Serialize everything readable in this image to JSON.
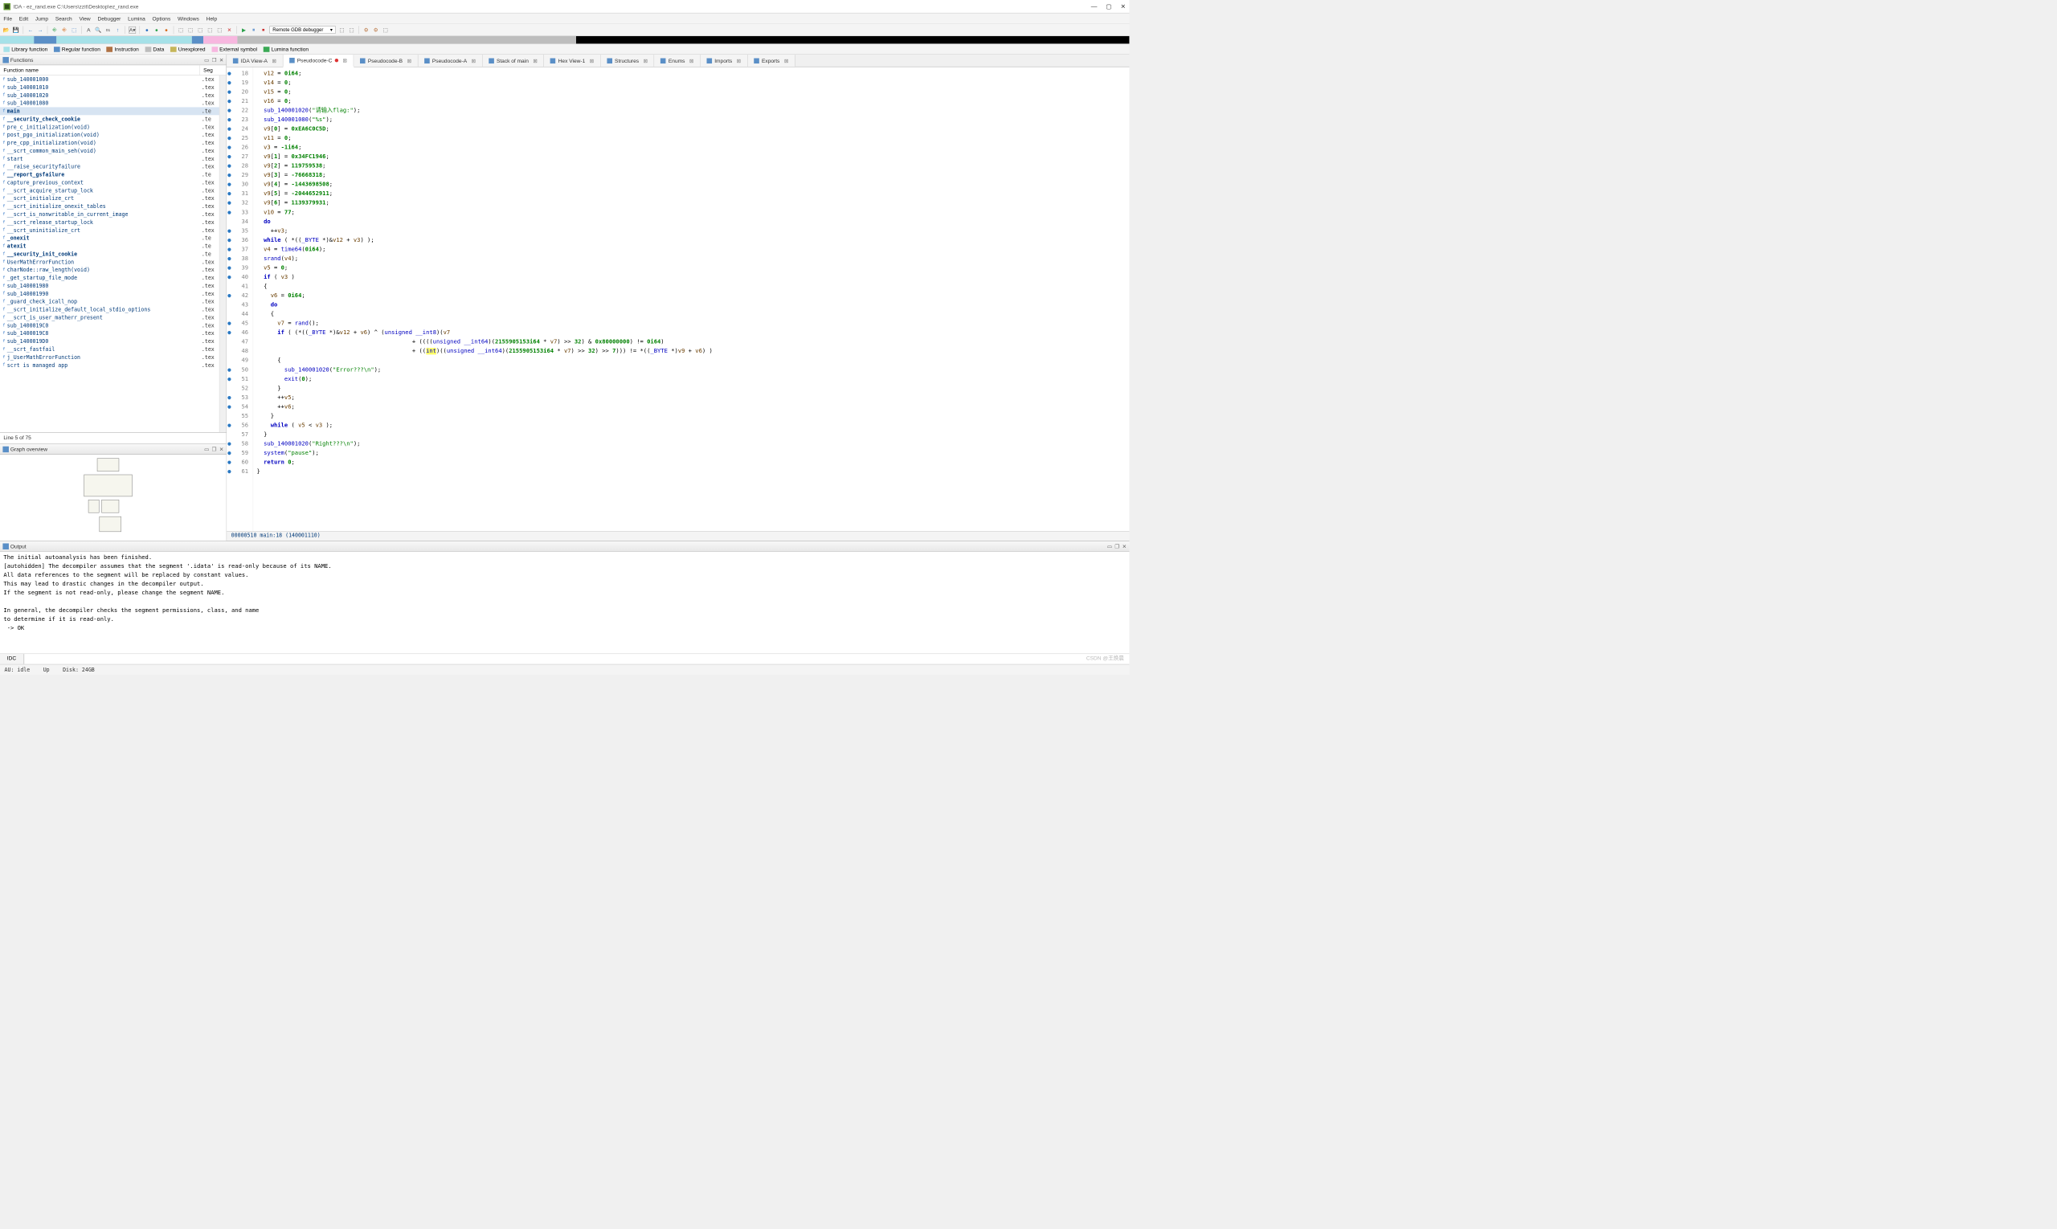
{
  "window": {
    "title": "IDA - ez_rand.exe C:\\Users\\zzit\\Desktop\\ez_rand.exe",
    "controls": {
      "min": "—",
      "max": "▢",
      "close": "✕"
    }
  },
  "menu": [
    "File",
    "Edit",
    "Jump",
    "Search",
    "View",
    "Debugger",
    "Lumina",
    "Options",
    "Windows",
    "Help"
  ],
  "toolbar": {
    "debugger": "Remote GDB debugger"
  },
  "legend": [
    {
      "color": "#a6e1e8",
      "label": "Library function"
    },
    {
      "color": "#5a8fc7",
      "label": "Regular function"
    },
    {
      "color": "#b07244",
      "label": "Instruction"
    },
    {
      "color": "#bdbdbd",
      "label": "Data"
    },
    {
      "color": "#c6b65a",
      "label": "Unexplored"
    },
    {
      "color": "#f7b7df",
      "label": "External symbol"
    },
    {
      "color": "#3aa955",
      "label": "Lumina function"
    }
  ],
  "functions": {
    "title": "Functions",
    "columns": [
      "Function name",
      "Seg"
    ],
    "line_status": "Line 5 of 75",
    "rows": [
      {
        "n": "sub_140001000",
        "s": ".tex",
        "b": false
      },
      {
        "n": "sub_140001010",
        "s": ".tex",
        "b": false
      },
      {
        "n": "sub_140001020",
        "s": ".tex",
        "b": false
      },
      {
        "n": "sub_140001080",
        "s": ".tex",
        "b": false
      },
      {
        "n": "main",
        "s": ".te",
        "b": true,
        "sel": true
      },
      {
        "n": "__security_check_cookie",
        "s": ".te",
        "b": true
      },
      {
        "n": "pre_c_initialization(void)",
        "s": ".tex",
        "b": false
      },
      {
        "n": "post_pgo_initialization(void)",
        "s": ".tex",
        "b": false
      },
      {
        "n": "pre_cpp_initialization(void)",
        "s": ".tex",
        "b": false
      },
      {
        "n": "__scrt_common_main_seh(void)",
        "s": ".tex",
        "b": false
      },
      {
        "n": "start",
        "s": ".tex",
        "b": false
      },
      {
        "n": "__raise_securityfailure",
        "s": ".tex",
        "b": false
      },
      {
        "n": "__report_gsfailure",
        "s": ".te",
        "b": true
      },
      {
        "n": "capture_previous_context",
        "s": ".tex",
        "b": false
      },
      {
        "n": "__scrt_acquire_startup_lock",
        "s": ".tex",
        "b": false
      },
      {
        "n": "__scrt_initialize_crt",
        "s": ".tex",
        "b": false
      },
      {
        "n": "__scrt_initialize_onexit_tables",
        "s": ".tex",
        "b": false
      },
      {
        "n": "__scrt_is_nonwritable_in_current_image",
        "s": ".tex",
        "b": false
      },
      {
        "n": "__scrt_release_startup_lock",
        "s": ".tex",
        "b": false
      },
      {
        "n": "__scrt_uninitialize_crt",
        "s": ".tex",
        "b": false
      },
      {
        "n": "_onexit",
        "s": ".te",
        "b": true
      },
      {
        "n": "atexit",
        "s": ".te",
        "b": true
      },
      {
        "n": "__security_init_cookie",
        "s": ".te",
        "b": true
      },
      {
        "n": "UserMathErrorFunction",
        "s": ".tex",
        "b": false
      },
      {
        "n": "charNode::raw_length(void)",
        "s": ".tex",
        "b": false
      },
      {
        "n": "_get_startup_file_mode",
        "s": ".tex",
        "b": false
      },
      {
        "n": "sub_140001980",
        "s": ".tex",
        "b": false
      },
      {
        "n": "sub_140001990",
        "s": ".tex",
        "b": false
      },
      {
        "n": "_guard_check_icall_nop",
        "s": ".tex",
        "b": false
      },
      {
        "n": "__scrt_initialize_default_local_stdio_options",
        "s": ".tex",
        "b": false
      },
      {
        "n": "__scrt_is_user_matherr_present",
        "s": ".tex",
        "b": false
      },
      {
        "n": "sub_1400019C0",
        "s": ".tex",
        "b": false
      },
      {
        "n": "sub_1400019C8",
        "s": ".tex",
        "b": false
      },
      {
        "n": "sub_1400019D0",
        "s": ".tex",
        "b": false
      },
      {
        "n": "__scrt_fastfail",
        "s": ".tex",
        "b": false
      },
      {
        "n": "j_UserMathErrorFunction",
        "s": ".tex",
        "b": false
      },
      {
        "n": "scrt is managed app",
        "s": ".tex",
        "b": false
      }
    ]
  },
  "graph": {
    "title": "Graph overview"
  },
  "tabs": [
    {
      "label": "IDA View-A",
      "active": false
    },
    {
      "label": "Pseudocode-C",
      "active": true,
      "dot": true
    },
    {
      "label": "Pseudocode-B",
      "active": false
    },
    {
      "label": "Pseudocode-A",
      "active": false
    },
    {
      "label": "Stack of main",
      "active": false
    },
    {
      "label": "Hex View-1",
      "active": false
    },
    {
      "label": "Structures",
      "active": false
    },
    {
      "label": "Enums",
      "active": false
    },
    {
      "label": "Imports",
      "active": false
    },
    {
      "label": "Exports",
      "active": false
    }
  ],
  "code": {
    "lines": [
      {
        "n": 18,
        "bp": true,
        "html": "  <span class='var'>v12</span> = <span class='num'>0i64</span>;"
      },
      {
        "n": 19,
        "bp": true,
        "html": "  <span class='var'>v14</span> = <span class='num'>0</span>;"
      },
      {
        "n": 20,
        "bp": true,
        "html": "  <span class='var'>v15</span> = <span class='num'>0</span>;"
      },
      {
        "n": 21,
        "bp": true,
        "html": "  <span class='var'>v16</span> = <span class='num'>0</span>;"
      },
      {
        "n": 22,
        "bp": true,
        "html": "  <span class='fn'>sub_140001020</span>(<span class='str'>\"请输入flag:\"</span>);"
      },
      {
        "n": 23,
        "bp": true,
        "html": "  <span class='fn'>sub_140001080</span>(<span class='str'>\"%s\"</span>);"
      },
      {
        "n": 24,
        "bp": true,
        "html": "  <span class='var'>v9</span>[<span class='num'>0</span>] = <span class='num'>0xEA6C0C5D</span>;"
      },
      {
        "n": 25,
        "bp": true,
        "html": "  <span class='var'>v11</span> = <span class='num'>0</span>;"
      },
      {
        "n": 26,
        "bp": true,
        "html": "  <span class='var'>v3</span> = <span class='num'>-1i64</span>;"
      },
      {
        "n": 27,
        "bp": true,
        "html": "  <span class='var'>v9</span>[<span class='num'>1</span>] = <span class='num'>0x34FC1946</span>;"
      },
      {
        "n": 28,
        "bp": true,
        "html": "  <span class='var'>v9</span>[<span class='num'>2</span>] = <span class='num'>119759538</span>;"
      },
      {
        "n": 29,
        "bp": true,
        "html": "  <span class='var'>v9</span>[<span class='num'>3</span>] = <span class='num'>-76668318</span>;"
      },
      {
        "n": 30,
        "bp": true,
        "html": "  <span class='var'>v9</span>[<span class='num'>4</span>] = <span class='num'>-1443698508</span>;"
      },
      {
        "n": 31,
        "bp": true,
        "html": "  <span class='var'>v9</span>[<span class='num'>5</span>] = <span class='num'>-2044652911</span>;"
      },
      {
        "n": 32,
        "bp": true,
        "html": "  <span class='var'>v9</span>[<span class='num'>6</span>] = <span class='num'>1139379931</span>;"
      },
      {
        "n": 33,
        "bp": true,
        "html": "  <span class='var'>v10</span> = <span class='num'>77</span>;"
      },
      {
        "n": 34,
        "bp": false,
        "html": "  <span class='kw'>do</span>"
      },
      {
        "n": 35,
        "bp": true,
        "html": "    ++<span class='var'>v3</span>;"
      },
      {
        "n": 36,
        "bp": true,
        "html": "  <span class='kw'>while</span> ( *((<span class='ty'>_BYTE</span> *)&amp;<span class='var'>v12</span> + <span class='var'>v3</span>) );"
      },
      {
        "n": 37,
        "bp": true,
        "html": "  <span class='var'>v4</span> = <span class='fn'>time64</span>(<span class='num'>0i64</span>);"
      },
      {
        "n": 38,
        "bp": true,
        "html": "  <span class='fn'>srand</span>(<span class='var'>v4</span>);"
      },
      {
        "n": 39,
        "bp": true,
        "html": "  <span class='var'>v5</span> = <span class='num'>0</span>;"
      },
      {
        "n": 40,
        "bp": true,
        "html": "  <span class='kw'>if</span> ( <span class='var'>v3</span> )"
      },
      {
        "n": 41,
        "bp": false,
        "html": "  {"
      },
      {
        "n": 42,
        "bp": true,
        "html": "    <span class='var'>v6</span> = <span class='num'>0i64</span>;"
      },
      {
        "n": 43,
        "bp": false,
        "html": "    <span class='kw'>do</span>"
      },
      {
        "n": 44,
        "bp": false,
        "html": "    {"
      },
      {
        "n": 45,
        "bp": true,
        "html": "      <span class='var'>v7</span> = <span class='fn'>rand</span>();"
      },
      {
        "n": 46,
        "bp": true,
        "html": "      <span class='kw'>if</span> ( (*((<span class='ty'>_BYTE</span> *)&amp;<span class='var'>v12</span> + <span class='var'>v6</span>) ^ (<span class='ty'>unsigned</span> <span class='ty'>__int8</span>)(<span class='var'>v7</span>"
      },
      {
        "n": 47,
        "bp": false,
        "html": "                                             + ((((<span class='ty'>unsigned</span> <span class='ty'>__int64</span>)(<span class='num'>2155905153i64</span> * <span class='var'>v7</span>) &gt;&gt; <span class='num'>32</span>) &amp; <span class='num'>0x80000000</span>) != <span class='num'>0i64</span>)"
      },
      {
        "n": 48,
        "bp": false,
        "html": "                                             + ((<span class='ty hl'>int</span>)((<span class='ty'>unsigned</span> <span class='ty'>__int64</span>)(<span class='num'>2155905153i64</span> * <span class='var'>v7</span>) &gt;&gt; <span class='num'>32</span>) &gt;&gt; <span class='num'>7</span>))) != *((<span class='ty'>_BYTE</span> *)<span class='var'>v9</span> + <span class='var'>v6</span>) )"
      },
      {
        "n": 49,
        "bp": false,
        "html": "      {"
      },
      {
        "n": 50,
        "bp": true,
        "html": "        <span class='fn'>sub_140001020</span>(<span class='str'>\"Error???\\n\"</span>);"
      },
      {
        "n": 51,
        "bp": true,
        "html": "        <span class='fn'>exit</span>(<span class='num'>0</span>);"
      },
      {
        "n": 52,
        "bp": false,
        "html": "      }"
      },
      {
        "n": 53,
        "bp": true,
        "html": "      ++<span class='var'>v5</span>;"
      },
      {
        "n": 54,
        "bp": true,
        "html": "      ++<span class='var'>v6</span>;"
      },
      {
        "n": 55,
        "bp": false,
        "html": "    }"
      },
      {
        "n": 56,
        "bp": true,
        "html": "    <span class='kw'>while</span> ( <span class='var'>v5</span> &lt; <span class='var'>v3</span> );"
      },
      {
        "n": 57,
        "bp": false,
        "html": "  }"
      },
      {
        "n": 58,
        "bp": true,
        "html": "  <span class='fn'>sub_140001020</span>(<span class='str'>\"Right???\\n\"</span>);"
      },
      {
        "n": 59,
        "bp": true,
        "html": "  <span class='fn'>system</span>(<span class='str'>\"pause\"</span>);"
      },
      {
        "n": 60,
        "bp": true,
        "html": "  <span class='kw'>return</span> <span class='num'>0</span>;"
      },
      {
        "n": 61,
        "bp": true,
        "html": "}"
      }
    ],
    "status": "00000510 main:18 (140001110)"
  },
  "output": {
    "title": "Output",
    "lines": [
      "The initial autoanalysis has been finished.",
      "[autohidden] The decompiler assumes that the segment '.idata' is read-only because of its NAME.",
      "All data references to the segment will be replaced by constant values.",
      "This may lead to drastic changes in the decompiler output.",
      "If the segment is not read-only, please change the segment NAME.",
      "",
      "In general, the decompiler checks the segment permissions, class, and name",
      "to determine if it is read-only.",
      " -> OK"
    ],
    "idc": "IDC"
  },
  "status": {
    "au": "AU:  idle",
    "up": "Up",
    "disk": "Disk: 24GB"
  },
  "watermark": "CSDN @王焕晨"
}
